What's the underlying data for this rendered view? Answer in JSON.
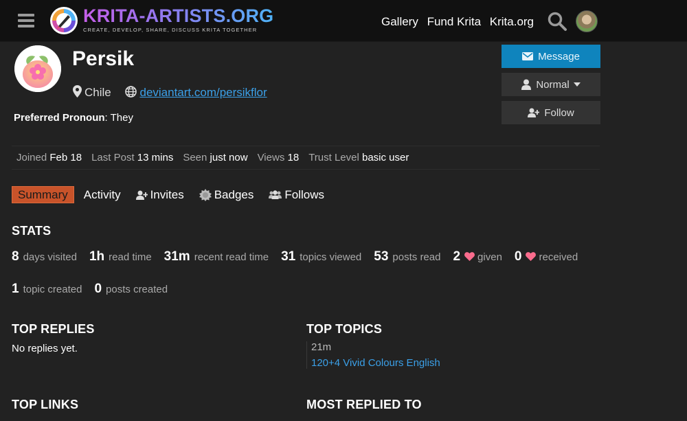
{
  "header": {
    "logo_title": "KRITA-ARTISTS.ORG",
    "logo_tagline": "CREATE, DEVELOP, SHARE, DISCUSS KRITA TOGETHER",
    "nav": [
      "Gallery",
      "Fund Krita",
      "Krita.org"
    ],
    "icons": [
      "menu-icon",
      "search-icon"
    ]
  },
  "profile": {
    "name": "Persik",
    "location": "Chile",
    "website": "deviantart.com/persikflor",
    "pronoun_label": "Preferred Pronoun",
    "pronoun_value": ": They"
  },
  "actions": {
    "message": "Message",
    "notification_level": "Normal",
    "follow": "Follow"
  },
  "meta": {
    "joined_label": "Joined",
    "joined_value": "Feb 18",
    "last_post_label": "Last Post",
    "last_post_value": "13 mins",
    "seen_label": "Seen",
    "seen_value": "just now",
    "views_label": "Views",
    "views_value": "18",
    "trust_label": "Trust Level",
    "trust_value": "basic user"
  },
  "tabs": [
    "Summary",
    "Activity",
    "Invites",
    "Badges",
    "Follows"
  ],
  "stats": {
    "title": "STATS",
    "row1": [
      {
        "num": "8",
        "label": "days visited"
      },
      {
        "num": "1h",
        "label": "read time"
      },
      {
        "num": "31m",
        "label": "recent read time"
      },
      {
        "num": "31",
        "label": "topics viewed"
      },
      {
        "num": "53",
        "label": "posts read"
      },
      {
        "num": "2",
        "label": "given"
      },
      {
        "num": "0",
        "label": "received"
      }
    ],
    "row2": [
      {
        "num": "1",
        "label": "topic created"
      },
      {
        "num": "0",
        "label": "posts created"
      }
    ]
  },
  "sections": {
    "top_replies": "TOP REPLIES",
    "no_replies": "No replies yet.",
    "top_topics": "TOP TOPICS",
    "topic_age": "21m",
    "topic_title": "120+4 Vivid Colours English",
    "top_links": "TOP LINKS",
    "most_replied": "MOST REPLIED TO"
  },
  "colors": {
    "accent_blue": "#0f84bd",
    "active_tab": "#c8532a",
    "link": "#3ba0e8",
    "heart": "#fa6c8d"
  }
}
